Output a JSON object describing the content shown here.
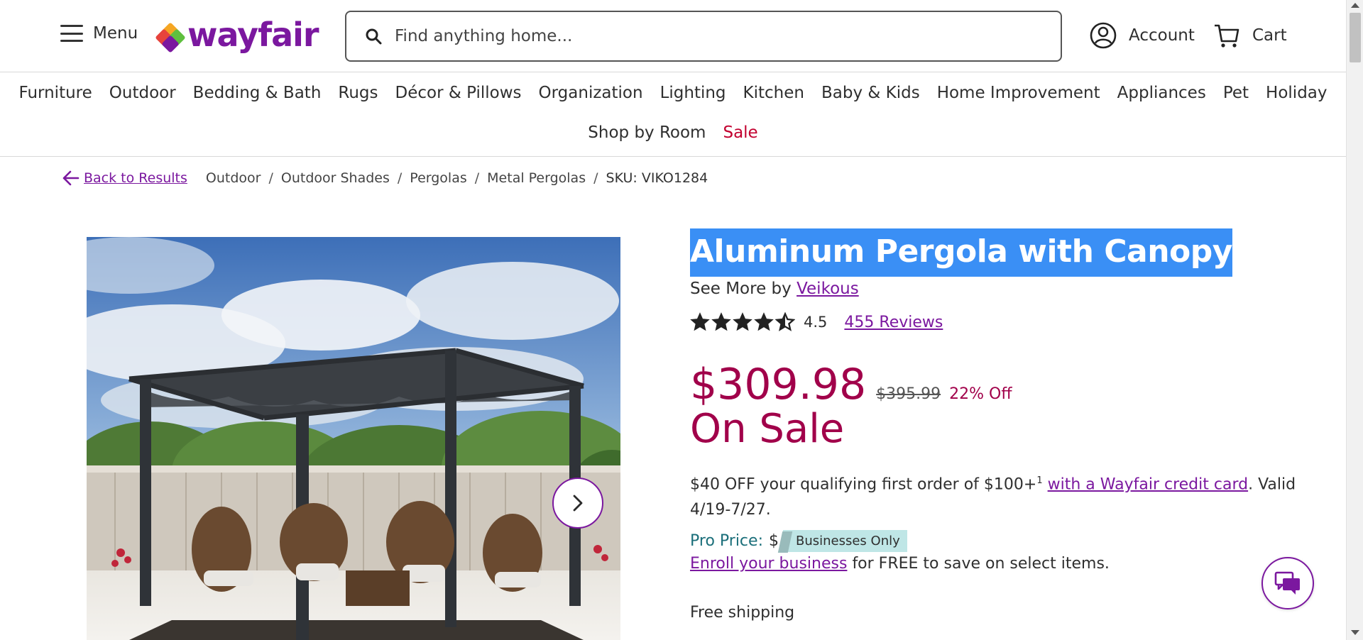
{
  "header": {
    "menu_label": "Menu",
    "logo_text": "wayfair",
    "search_placeholder": "Find anything home...",
    "account_label": "Account",
    "cart_label": "Cart"
  },
  "categories": {
    "row1": [
      "Furniture",
      "Outdoor",
      "Bedding & Bath",
      "Rugs",
      "Décor & Pillows",
      "Organization",
      "Lighting",
      "Kitchen",
      "Baby & Kids",
      "Home Improvement",
      "Appliances",
      "Pet",
      "Holiday"
    ],
    "row2": [
      "Shop by Room",
      "Sale"
    ]
  },
  "breadcrumb": {
    "back_label": "Back to Results",
    "items": [
      "Outdoor",
      "Outdoor Shades",
      "Pergolas",
      "Metal Pergolas"
    ],
    "sku": "SKU: VIKO1284"
  },
  "product": {
    "title": "Aluminum Pergola with Canopy",
    "see_more_prefix": "See More by",
    "brand": "Veikous",
    "rating": "4.5",
    "rating_value": 4.5,
    "reviews_label": "455 Reviews",
    "price": "$309.98",
    "old_price": "$395.99",
    "discount": "22% Off",
    "sale_label": "On Sale",
    "promo_text_1": "$40 OFF your qualifying first order of $100+",
    "promo_sup": "1",
    "promo_link": "with a Wayfair credit card",
    "promo_text_2": ". Valid 4/19-7/27.",
    "pro_price_label": "Pro Price:",
    "pro_price_dollar": "$",
    "businesses_badge": "Businesses Only",
    "enroll_link": "Enroll your business",
    "enroll_text": "for FREE to save on select items.",
    "shipping": "Free shipping"
  },
  "colors": {
    "brand_purple": "#7b189f",
    "sale_red": "#a1004a",
    "selection_blue": "#3a8ff5"
  }
}
